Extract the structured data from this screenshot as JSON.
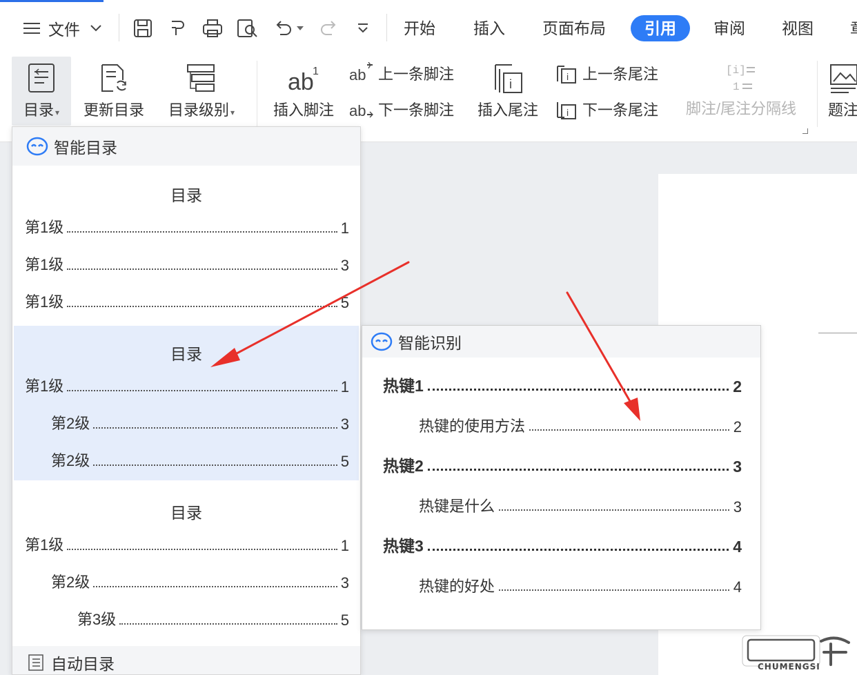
{
  "menubar": {
    "file_label": "文件",
    "tabs": [
      "开始",
      "插入",
      "页面布局",
      "引用",
      "审阅",
      "视图",
      "章"
    ],
    "active_tab": "引用"
  },
  "ribbon": {
    "toc_label": "目录",
    "update_toc_label": "更新目录",
    "toc_level_label": "目录级别",
    "insert_footnote_label": "插入脚注",
    "prev_footnote_label": "上一条脚注",
    "next_footnote_label": "下一条脚注",
    "insert_endnote_label": "插入尾注",
    "prev_endnote_label": "上一条尾注",
    "next_endnote_label": "下一条尾注",
    "separator_label": "脚注/尾注分隔线",
    "caption_label": "题注"
  },
  "toc_panel": {
    "header": "智能目录",
    "presets": [
      {
        "title": "目录",
        "lines": [
          {
            "text": "第1级",
            "page": "1"
          },
          {
            "text": "第1级",
            "page": "3"
          },
          {
            "text": "第1级",
            "page": "5"
          }
        ]
      },
      {
        "title": "目录",
        "lines": [
          {
            "text": "第1级",
            "page": "1"
          },
          {
            "text": "第2级",
            "page": "3"
          },
          {
            "text": "第2级",
            "page": "5"
          }
        ]
      },
      {
        "title": "目录",
        "lines": [
          {
            "text": "第1级",
            "page": "1"
          },
          {
            "text": "第2级",
            "page": "3"
          },
          {
            "text": "第3级",
            "page": "5"
          }
        ]
      }
    ],
    "footer": "自动目录"
  },
  "smart_card": {
    "header": "智能识别",
    "lines": [
      {
        "text": "热键1",
        "page": "2"
      },
      {
        "text": "热键的使用方法",
        "page": "2"
      },
      {
        "text": "热键2",
        "page": "3"
      },
      {
        "text": "热键是什么",
        "page": "3"
      },
      {
        "text": "热键3",
        "page": "4"
      },
      {
        "text": "热键的好处",
        "page": "4"
      }
    ]
  },
  "watermark": {
    "text": "CHUMENGSI"
  },
  "colors": {
    "accent": "#2e7cf6",
    "hover_bg": "#e5edfb",
    "arrow": "#e8302a"
  }
}
